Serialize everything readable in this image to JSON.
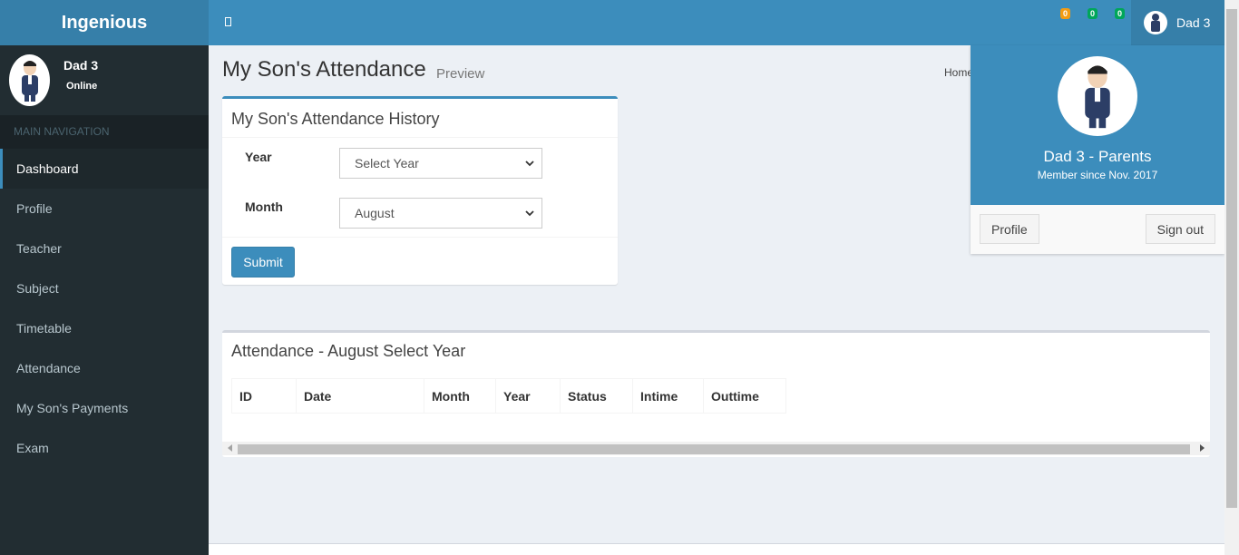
{
  "app": {
    "logo": "Ingenious"
  },
  "header": {
    "badges": [
      "0",
      "0",
      "0"
    ],
    "user_name": "Dad 3"
  },
  "sidebar": {
    "user": {
      "name": "Dad 3",
      "status": "Online"
    },
    "nav_header": "MAIN NAVIGATION",
    "items": [
      {
        "label": "Dashboard",
        "active": true
      },
      {
        "label": "Profile"
      },
      {
        "label": "Teacher"
      },
      {
        "label": "Subject"
      },
      {
        "label": "Timetable"
      },
      {
        "label": "Attendance"
      },
      {
        "label": "My Son's Payments"
      },
      {
        "label": "Exam"
      }
    ]
  },
  "page": {
    "title": "My Son's Attendance",
    "subtitle": "Preview",
    "breadcrumb": "Home"
  },
  "history_box": {
    "title": "My Son's Attendance History",
    "year_label": "Year",
    "year_value": "Select Year",
    "month_label": "Month",
    "month_value": "August",
    "submit_label": "Submit"
  },
  "attendance_box": {
    "title": "Attendance - August Select Year",
    "columns": [
      "ID",
      "Date",
      "Month",
      "Year",
      "Status",
      "Intime",
      "Outtime"
    ]
  },
  "user_dropdown": {
    "name": "Dad 3 - Parents",
    "member_since": "Member since Nov. 2017",
    "profile_label": "Profile",
    "signout_label": "Sign out"
  }
}
